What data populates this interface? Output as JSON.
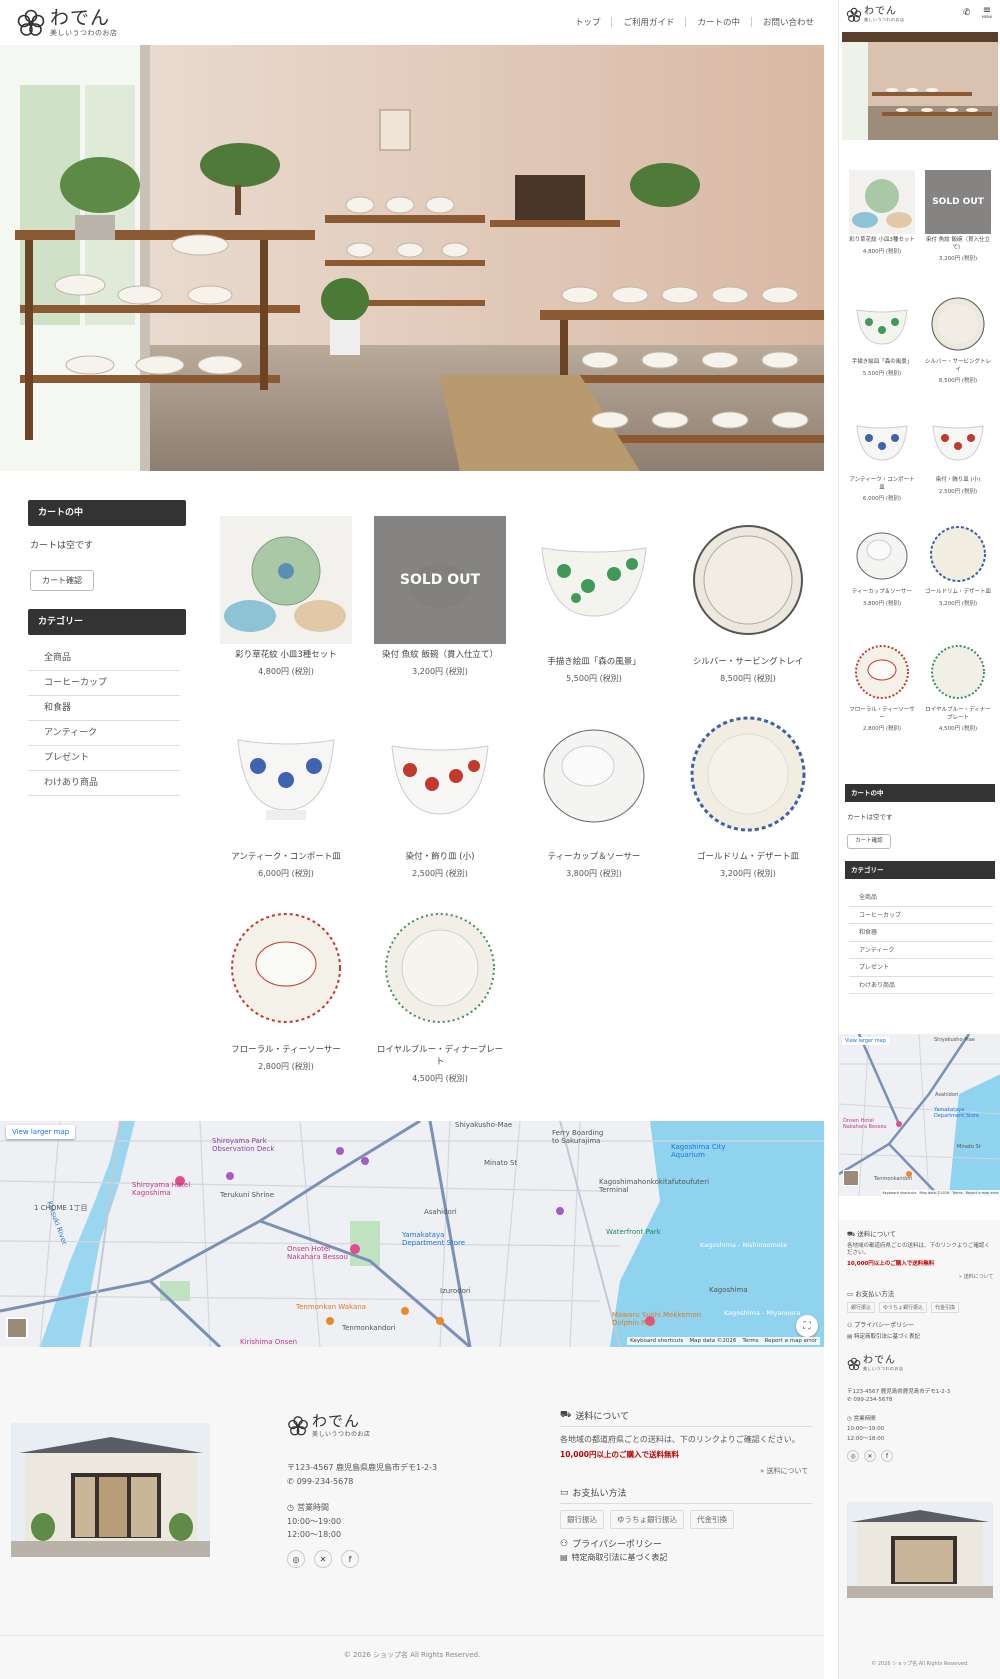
{
  "brand": {
    "name": "わでん",
    "tagline": "美しいうつわのお店"
  },
  "nav": {
    "items": [
      "トップ",
      "ご利用ガイド",
      "カートの中",
      "お問い合わせ"
    ]
  },
  "sidebar": {
    "cart_heading": "カートの中",
    "cart_empty": "カートは空です",
    "cart_button": "カート確認",
    "category_heading": "カテゴリー",
    "categories": [
      "全商品",
      "コーヒーカップ",
      "和食器",
      "アンティーク",
      "プレゼント",
      "わけあり商品"
    ]
  },
  "products": [
    {
      "name": "彩り草花紋 小皿3種セット",
      "price": "4,800円 (税別)",
      "sold_out": false
    },
    {
      "name": "染付 魚紋 飯碗（貫入仕立て）",
      "price": "3,200円 (税別)",
      "sold_out": true
    },
    {
      "name": "手描き絵皿「森の風景」",
      "price": "5,500円 (税別)",
      "sold_out": false
    },
    {
      "name": "シルバー・サービングトレイ",
      "price": "8,500円 (税別)",
      "sold_out": false
    },
    {
      "name": "アンティーク・コンポート皿",
      "price": "6,000円 (税別)",
      "sold_out": false
    },
    {
      "name": "染付・飾り皿 (小)",
      "price": "2,500円 (税別)",
      "sold_out": false
    },
    {
      "name": "ティーカップ＆ソーサー",
      "price": "3,800円 (税別)",
      "sold_out": false
    },
    {
      "name": "ゴールドリム・デザート皿",
      "price": "3,200円 (税別)",
      "sold_out": false
    },
    {
      "name": "フローラル・ティーソーサー",
      "price": "2,800円 (税別)",
      "sold_out": false
    },
    {
      "name": "ロイヤルブルー・ディナープレート",
      "price": "4,500円 (税別)",
      "sold_out": false
    }
  ],
  "sold_out_label": "SOLD OUT",
  "map": {
    "view_larger": "View larger map",
    "labels": [
      "Shiroyama Park Observation Deck",
      "Shiroyama Hotel Kagoshima",
      "Terukuni Shrine",
      "Asahidori",
      "Yamakataya Department Store",
      "Onsen Hotel Nakahara Bessou",
      "Tenmonkan Wakana",
      "Izurodori",
      "Tenmonkandori",
      "Kagoshima City Aquarium",
      "Kagoshimahonkokitafutoufuteri Terminal",
      "Ferry Boarding to Sakurajima",
      "Waterfront Park",
      "Kagoshima",
      "Mawaru Sushi Mekkemon Dolphin Port",
      "Kirishima Onsen",
      "Shiyakusho-Mae",
      "Kotsuki River",
      "Minato St",
      "Kagoshima - Nishinoomote",
      "Kagoshima - Miyanoura",
      "1 CHOME 1丁目"
    ],
    "attribution": [
      "Keyboard shortcuts",
      "Map data ©2026",
      "Terms",
      "Report a map error"
    ]
  },
  "footer": {
    "address": "〒123-4567 鹿児島県鹿児島市デモ1-2-3",
    "phone": "099-234-5678",
    "hours_title": "営業時間",
    "hours": [
      "10:00〜19:00",
      "12:00〜18:00"
    ],
    "shipping_title": "送料について",
    "shipping_text": "各地域の都道府県ごとの送料は、下のリンクよりご確認ください。",
    "shipping_free": "10,000円以上のご購入で送料無料",
    "shipping_link": "» 送料について",
    "payment_title": "お支払い方法",
    "payment_methods": [
      "銀行振込",
      "ゆうちょ銀行振込",
      "代金引換"
    ],
    "privacy": "プライバシーポリシー",
    "tokusho": "特定商取引法に基づく表記",
    "copyright": "© 2026 ショップ名 All Rights Reserved.",
    "sns": [
      "instagram-icon",
      "x-icon",
      "facebook-icon"
    ]
  },
  "mobile": {
    "menu_label": "MENU"
  },
  "colors": {
    "dark": "#333333",
    "accent_red": "#c00000",
    "bg_footer": "#f7f7f7"
  }
}
